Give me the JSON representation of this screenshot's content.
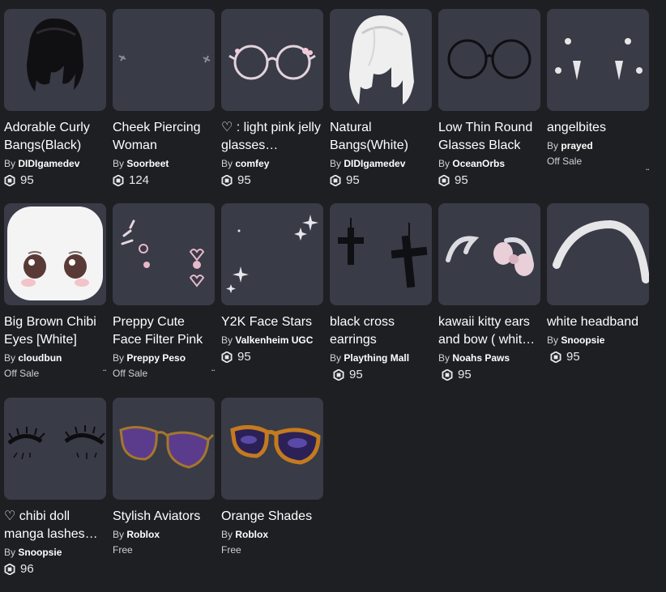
{
  "items": [
    {
      "name": "Adorable Curly Bangs(Black)",
      "by": "By",
      "creator": "DIDIgamedev",
      "price": "95",
      "status": ""
    },
    {
      "name": "Cheek Piercing Woman",
      "by": "By",
      "creator": "Soorbeet",
      "price": "124",
      "status": ""
    },
    {
      "name": "♡ : light pink jelly glasses…",
      "by": "By",
      "creator": "comfey",
      "price": "95",
      "status": ""
    },
    {
      "name": "Natural Bangs(White)",
      "by": "By",
      "creator": "DIDIgamedev",
      "price": "95",
      "status": ""
    },
    {
      "name": "Low Thin Round Glasses Black",
      "by": "By",
      "creator": "OceanOrbs",
      "price": "95",
      "status": ""
    },
    {
      "name": "angelbites",
      "by": "By",
      "creator": "prayed",
      "price": "",
      "status": "Off Sale"
    },
    {
      "name": "Big Brown Chibi Eyes [White]",
      "by": "By",
      "creator": "cloudbun",
      "price": "",
      "status": "Off Sale"
    },
    {
      "name": "Preppy Cute Face Filter Pink",
      "by": "By",
      "creator": "Preppy Peso",
      "price": "",
      "status": "Off Sale"
    },
    {
      "name": "Y2K Face Stars",
      "by": "By",
      "creator": "Valkenheim UGC",
      "price": "95",
      "status": ""
    },
    {
      "name": "black cross earrings",
      "by": "By",
      "creator": "Plaything Mall",
      "price": "95",
      "status": ""
    },
    {
      "name": "kawaii kitty ears and bow ( whit…",
      "by": "By",
      "creator": "Noahs Paws",
      "price": "95",
      "status": ""
    },
    {
      "name": "white headband",
      "by": "By",
      "creator": "Snoopsie",
      "price": "95",
      "status": ""
    },
    {
      "name": "♡ chibi doll manga lashes…",
      "by": "By",
      "creator": "Snoopsie",
      "price": "96",
      "status": ""
    },
    {
      "name": "Stylish Aviators",
      "by": "By",
      "creator": "Roblox",
      "price": "",
      "status": "Free"
    },
    {
      "name": "Orange Shades",
      "by": "By",
      "creator": "Roblox",
      "price": "",
      "status": "Free"
    }
  ],
  "more_dots": "..",
  "colors": {
    "background": "#1e1f23",
    "card": "#393b47",
    "text": "#ffffff"
  },
  "icons": {
    "price": "robux-icon"
  }
}
